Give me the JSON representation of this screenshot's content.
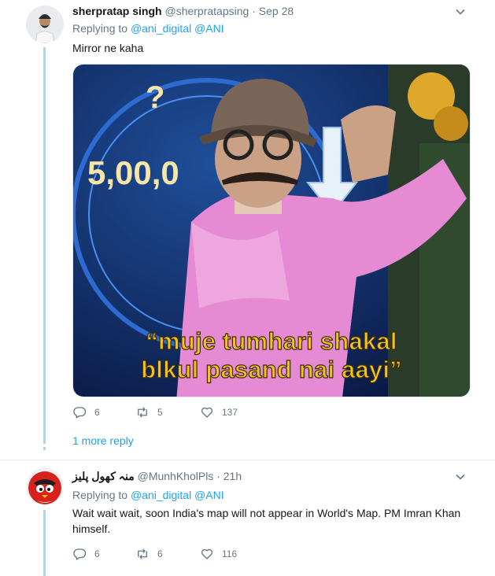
{
  "tweet1": {
    "name": "sherpratap singh",
    "handle": "@sherpratapsing",
    "dot": "·",
    "time": "Sep 28",
    "replying_label": "Replying to",
    "mentions": [
      "@ani_digital",
      "@ANI"
    ],
    "text": "Mirror ne kaha",
    "image": {
      "board_text": "5,00,0",
      "board_question": "?",
      "caption_line1": "“muje tumhari shakal",
      "caption_line2": "blkul pasand nai aayi”"
    },
    "reply_count": "6",
    "retweet_count": "5",
    "like_count": "137",
    "more_replies": "1 more reply"
  },
  "tweet2": {
    "name": "منہ کھول پلیز",
    "handle": "@MunhKholPls",
    "dot": "·",
    "time": "21h",
    "replying_label": "Replying to",
    "mentions": [
      "@ani_digital",
      "@ANI"
    ],
    "text": "Wait wait wait, soon India's map will not appear in World's Map. PM Imran Khan himself.",
    "reply_count": "6",
    "retweet_count": "6",
    "like_count": "116"
  },
  "colors": {
    "link": "#1da1f2",
    "muted": "#657786",
    "thread_line": "#a8d7f2",
    "caption": "#f4c21f"
  },
  "icons": [
    "reply-icon",
    "retweet-icon",
    "like-icon",
    "chevron-down-icon"
  ]
}
